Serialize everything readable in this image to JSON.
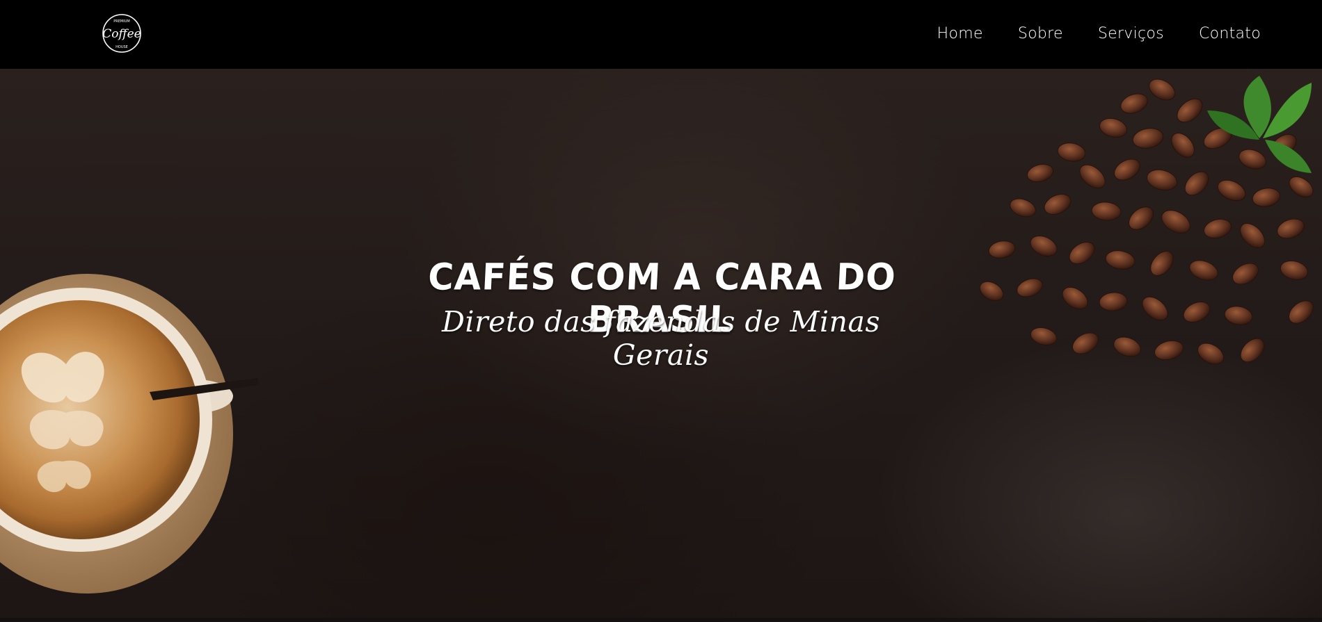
{
  "brand": {
    "logo_icon": "coffee-house-logo-icon",
    "logo_text_top": "PREMIUM",
    "logo_text_main": "Coffee",
    "logo_text_bottom": "HOUSE"
  },
  "nav": {
    "items": [
      {
        "label": "Home"
      },
      {
        "label": "Sobre"
      },
      {
        "label": "Serviços"
      },
      {
        "label": "Contato"
      }
    ]
  },
  "hero": {
    "title": "CAFÉS COM A CARA DO BRASIL",
    "subtitle": "Direto das fazendas de Minas Gerais",
    "cup_image": "latte-cup-image",
    "beans_image": "coffee-beans-image"
  },
  "colors": {
    "navbar": "#000000",
    "hero_bg": "#231b19",
    "text": "#ffffff"
  }
}
